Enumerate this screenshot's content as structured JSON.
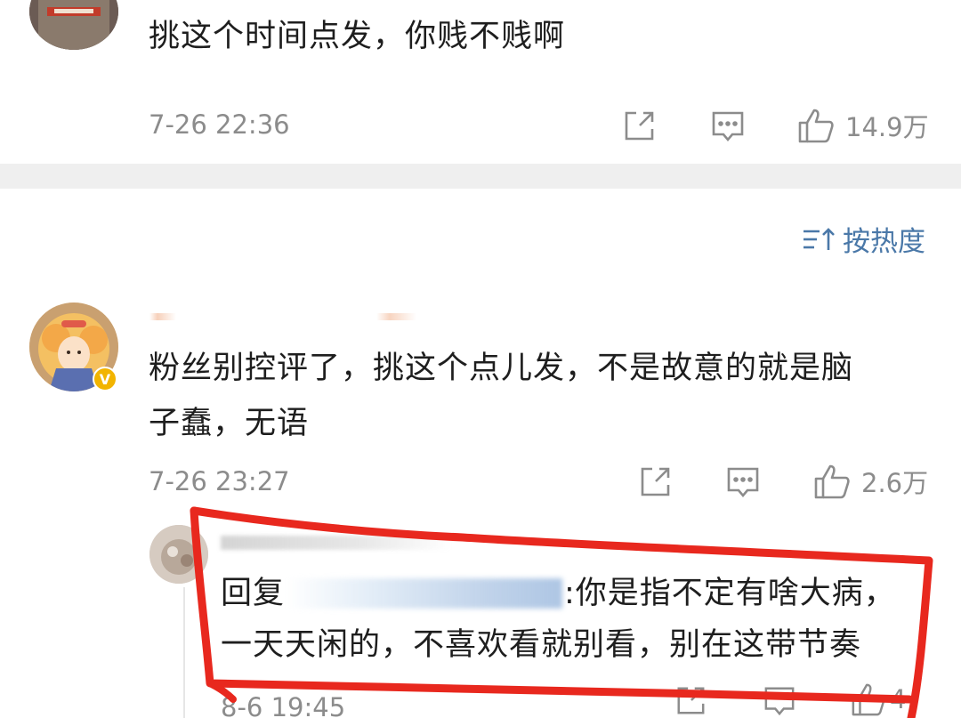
{
  "comments": [
    {
      "text": "挑这个时间点发，你贱不贱啊",
      "time": "7-26 22:36",
      "likes": "14.9万"
    },
    {
      "text_line1": "粉丝别控评了，挑这个点儿发，不是故意的就是脑",
      "text_line2": "子蠢，无语",
      "time": "7-26 23:27",
      "likes": "2.6万",
      "verified_badge": "V"
    }
  ],
  "sort": {
    "label": "按热度"
  },
  "reply": {
    "line1_prefix": "回复",
    "line1_rest": ":你是指不定有啥大病，",
    "line2": "一天天闲的，不喜欢看就别看，别在这带节奏",
    "time": "8-6 19:45",
    "likes_partial": "4"
  },
  "colors": {
    "accent_link": "#4a78a8",
    "meta_gray": "#8c8c8c",
    "divider": "#efefef",
    "highlight_red": "#e8281e",
    "verified_gold": "#f2b400"
  }
}
